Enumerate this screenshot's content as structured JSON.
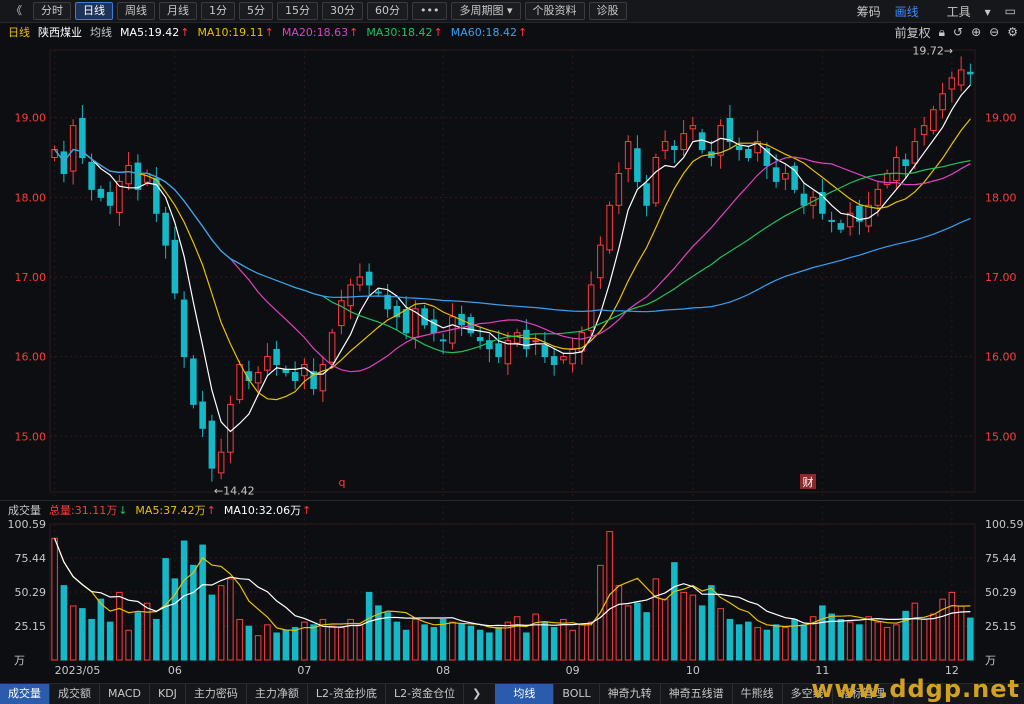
{
  "toolbar": {
    "back": "《",
    "tabs": [
      "分时",
      "日线",
      "周线",
      "月线",
      "1分",
      "5分",
      "15分",
      "30分",
      "60分"
    ],
    "active_tab": "日线",
    "more": "•••",
    "multi_period": "多周期图",
    "stock_info": "个股资料",
    "diagnose": "诊股",
    "right": {
      "chips": "筹码",
      "draw": "画线",
      "tools": "工具"
    }
  },
  "info": {
    "period": "日线",
    "name": "陕西煤业",
    "avg_label": "均线",
    "ma5": "MA5:19.42",
    "ma10": "MA10:19.11",
    "ma20": "MA20:18.63",
    "ma30": "MA30:18.42",
    "ma60": "MA60:18.42",
    "adjust": "前复权"
  },
  "vol_info": {
    "title": "成交量",
    "total": "总量:31.11万",
    "ma5": "MA5:37.42万",
    "ma10": "MA10:32.06万"
  },
  "bottom_tabs": [
    "成交量",
    "成交额",
    "MACD",
    "KDJ",
    "主力密码",
    "主力净额",
    "L2-资金抄底",
    "L2-资金仓位"
  ],
  "bottom_right_tabs": [
    "均线",
    "BOLL",
    "神奇九转",
    "神奇五线谱",
    "牛熊线",
    "多空线",
    "指标管理"
  ],
  "watermark": "www.ddgp.net",
  "colors": {
    "up": "#ff3b3b",
    "down": "#15b8c7",
    "ma5": "#ffffff",
    "ma10": "#e8c000",
    "ma20": "#e040c0",
    "ma30": "#20c060",
    "ma60": "#3a9ff0",
    "bg": "#0d0e12"
  },
  "chart_data": [
    {
      "type": "candlestick",
      "title": "陕西煤业 日线",
      "y_ticks": [
        "19.00",
        "18.00",
        "17.00",
        "16.00",
        "15.00"
      ],
      "ylim": [
        14.3,
        19.85
      ],
      "x_ticks": [
        "2023/05",
        "06",
        "07",
        "08",
        "09",
        "10",
        "11",
        "12"
      ],
      "annotations": {
        "high": "19.72",
        "low": "14.42",
        "markers": [
          "q",
          "财"
        ]
      },
      "closes": [
        18.6,
        18.3,
        18.9,
        18.5,
        18.1,
        18.0,
        17.9,
        18.2,
        18.4,
        18.1,
        18.3,
        17.8,
        17.4,
        16.8,
        16.0,
        15.4,
        15.1,
        14.6,
        14.8,
        15.4,
        15.9,
        15.7,
        15.8,
        16.0,
        15.9,
        15.8,
        15.7,
        15.9,
        15.6,
        15.9,
        16.3,
        16.7,
        16.9,
        17.0,
        16.9,
        16.8,
        16.6,
        16.5,
        16.3,
        16.6,
        16.4,
        16.3,
        16.2,
        16.5,
        16.4,
        16.3,
        16.2,
        16.1,
        16.0,
        16.2,
        16.3,
        16.1,
        16.2,
        16.0,
        15.9,
        16.0,
        16.1,
        16.3,
        16.9,
        17.4,
        17.9,
        18.3,
        18.7,
        18.2,
        17.9,
        18.5,
        18.7,
        18.6,
        18.8,
        18.9,
        18.6,
        18.5,
        18.9,
        18.7,
        18.6,
        18.5,
        18.7,
        18.4,
        18.2,
        18.3,
        18.1,
        17.9,
        18.0,
        17.8,
        17.7,
        17.6,
        17.8,
        17.7,
        17.9,
        18.1,
        18.3,
        18.5,
        18.4,
        18.7,
        18.9,
        19.1,
        19.3,
        19.5,
        19.6,
        19.55
      ],
      "ma_series": [
        "MA5",
        "MA10",
        "MA20",
        "MA30",
        "MA60"
      ]
    },
    {
      "type": "bar",
      "title": "成交量",
      "unit": "万",
      "y_ticks": [
        "100.59",
        "75.44",
        "50.29",
        "25.15"
      ],
      "ylim": [
        0,
        100.59
      ],
      "volumes": [
        90,
        55,
        40,
        38,
        30,
        45,
        28,
        50,
        22,
        35,
        42,
        30,
        75,
        60,
        88,
        70,
        85,
        48,
        55,
        60,
        30,
        25,
        18,
        26,
        20,
        22,
        24,
        28,
        26,
        30,
        25,
        24,
        30,
        26,
        50,
        40,
        35,
        28,
        22,
        30,
        26,
        24,
        30,
        28,
        27,
        25,
        22,
        20,
        24,
        28,
        32,
        20,
        34,
        28,
        24,
        30,
        22,
        26,
        28,
        70,
        95,
        55,
        40,
        42,
        35,
        60,
        45,
        72,
        50,
        48,
        40,
        55,
        38,
        30,
        26,
        28,
        24,
        22,
        26,
        24,
        30,
        26,
        32,
        40,
        34,
        30,
        28,
        26,
        32,
        28,
        24,
        26,
        36,
        42,
        30,
        34,
        45,
        50,
        40,
        31
      ]
    }
  ]
}
